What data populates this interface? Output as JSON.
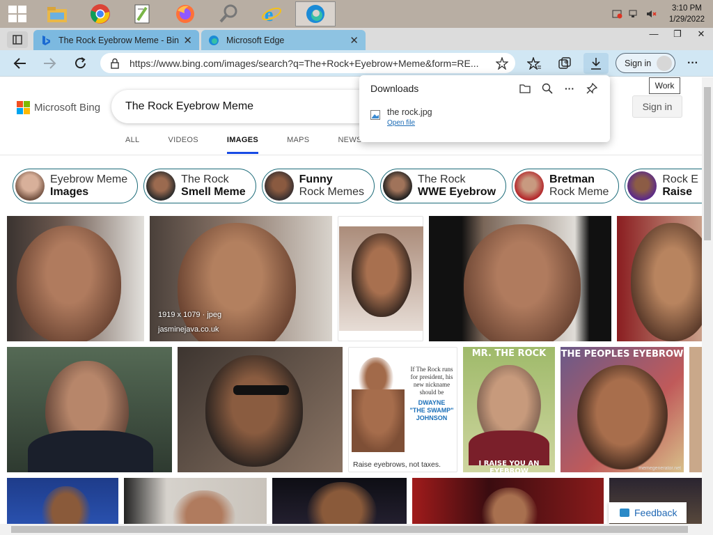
{
  "taskbar": {
    "apps": [
      "file-explorer",
      "chrome",
      "notepad-plus",
      "firefox",
      "search",
      "internet-explorer",
      "edge"
    ],
    "clock_time": "3:10 PM",
    "clock_date": "1/29/2022"
  },
  "tabs": [
    {
      "title": "The Rock Eyebrow Meme - Bing",
      "close": "✕"
    },
    {
      "title": "Microsoft Edge",
      "close": "✕"
    }
  ],
  "window_buttons": {
    "minimize": "—",
    "maximize": "❐",
    "close": "✕"
  },
  "address": {
    "url": "https://www.bing.com/images/search?q=The+Rock+Eyebrow+Meme&form=RE..."
  },
  "toolbar": {
    "signin": "Sign in",
    "more": "···"
  },
  "tooltip": "Work",
  "downloads": {
    "title": "Downloads",
    "file_name": "the rock.jpg",
    "open_file": "Open file",
    "more": "···"
  },
  "bing": {
    "logo": "Microsoft Bing",
    "query": "The Rock Eyebrow Meme",
    "signin": "Sign in",
    "scopes": [
      "ALL",
      "VIDEOS",
      "IMAGES",
      "MAPS",
      "NEWS"
    ],
    "active_scope": "IMAGES"
  },
  "chips": [
    {
      "line1": "Eyebrow Meme",
      "line2": "Images",
      "bold": "line2"
    },
    {
      "line1": "The Rock",
      "line2": "Smell Meme",
      "bold": "line2"
    },
    {
      "line1": "Funny",
      "line2": "Rock Memes",
      "bold": "line1"
    },
    {
      "line1": "The Rock",
      "line2": "WWE Eyebrow",
      "bold": "line2"
    },
    {
      "line1": "Bretman",
      "line2": "Rock Meme",
      "bold": "line1"
    },
    {
      "line1": "Rock E",
      "line2": "Raise",
      "bold": "line2"
    }
  ],
  "results": {
    "hover_meta": {
      "size": "1919 x 1079 · jpeg",
      "source": "jasminejava.co.uk"
    },
    "meme1_text": [
      "If The Rock runs",
      "for president, his",
      "new nickname",
      "should be"
    ],
    "meme1_highlight": [
      "DWAYNE",
      "\"THE SWAMP\"",
      "JOHNSON"
    ],
    "meme1_caption": "Raise eyebrows, not taxes.",
    "meme2_top": "MR. THE ROCK",
    "meme2_bottom": "I RAISE YOU AN EYEBROW",
    "meme3_top": "THE PEOPLES EYEBROW",
    "meme3_footer": "memegenerator.net"
  },
  "feedback": "Feedback",
  "colors": {
    "accent": "#174ae4",
    "tab_active": "#7cb9e0",
    "toolbar": "#d1e7f4",
    "taskbar": "#b8aea3"
  }
}
